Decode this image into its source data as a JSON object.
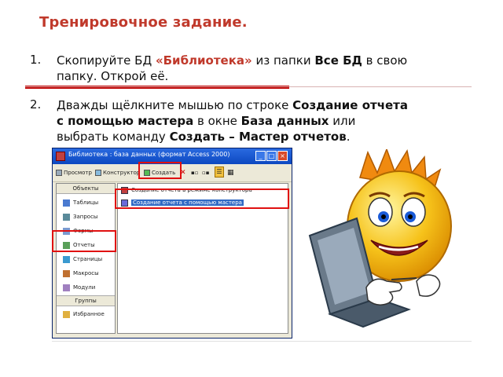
{
  "title": "Тренировочное задание.",
  "item1": {
    "number": "1.",
    "part1": "Скопируйте БД ",
    "highlight": "«Библиотека»",
    "part2": " из папки ",
    "bold": "Все БД",
    "part3": " в свою",
    "line2": "папку. Открой её."
  },
  "item2": {
    "number": "2.",
    "part1": "Дважды щёлкните мышью по строке ",
    "bold1": "Создание отчета",
    "bold2": " с помощью мастера",
    "part2": " в окне ",
    "bold3": "База данных",
    "part3": " или",
    "part4": "выбрать команду ",
    "bold4": "Создать – Мастер отчетов",
    "part5": "."
  },
  "window": {
    "title": "Библиотека : база данных (формат Access 2000)",
    "toolbar": {
      "preview": "Просмотр",
      "design": "Конструктор",
      "create": "Создать"
    },
    "objects_header": "Объекты",
    "objects": [
      "Таблицы",
      "Запросы",
      "Формы",
      "Отчеты",
      "Страницы",
      "Макросы",
      "Модули"
    ],
    "groups_header": "Группы",
    "groups": [
      "Избранное"
    ],
    "list": [
      "Создание отчета в режиме конструктора",
      "Создание отчета с помощью мастера"
    ]
  }
}
